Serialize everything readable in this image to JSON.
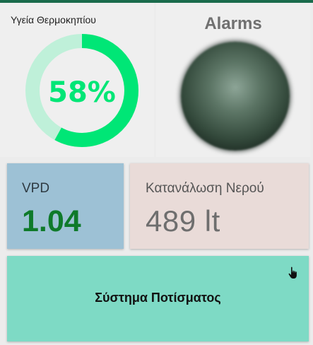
{
  "health": {
    "title": "Υγεία Θερμοκηπίου",
    "value_label": "58%",
    "percent": 58,
    "arc_color": "#00e676",
    "track_color": "#bff0d9"
  },
  "alarms": {
    "title": "Alarms",
    "led_state": "off",
    "led_color": "#5c7565"
  },
  "vpd": {
    "label": "VPD",
    "value": "1.04"
  },
  "water": {
    "label": "Κατανάλωση Νερού",
    "value": "489 lt"
  },
  "irrigation": {
    "label": "Σύστημα Ποτίσματος",
    "icon": "hand-pointer-icon"
  }
}
